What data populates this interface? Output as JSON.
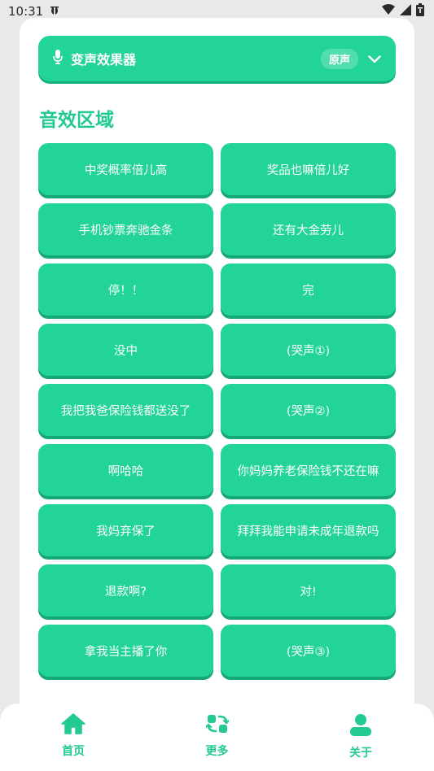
{
  "status_bar": {
    "time": "10:31",
    "carrier_icon": "bug-icon",
    "icons": [
      "wifi-icon",
      "signal-icon",
      "battery-icon"
    ]
  },
  "voice_changer": {
    "title": "变声效果器",
    "icon": "microphone-icon",
    "selected": "原声",
    "dropdown_icon": "chevron-down-icon"
  },
  "section": {
    "title": "音效区域"
  },
  "sound_buttons": [
    "中奖概率倍儿高",
    "奖品也嘛倍儿好",
    "手机钞票奔驰金条",
    "还有大金劳儿",
    "停！！",
    "完",
    "没中",
    "(哭声①)",
    "我把我爸保险钱都送没了",
    "(哭声②)",
    "啊哈哈",
    "你妈妈养老保险钱不还在嘛",
    "我妈弃保了",
    "拜拜我能申请未成年退款吗",
    "退款啊?",
    "对!",
    "拿我当主播了你",
    "(哭声③)"
  ],
  "bottom_nav": {
    "items": [
      {
        "label": "首页",
        "icon": "home-icon"
      },
      {
        "label": "更多",
        "icon": "refresh-icon"
      },
      {
        "label": "关于",
        "icon": "user-icon"
      }
    ]
  },
  "colors": {
    "accent": "#22d39a",
    "accent_dark": "#17a877",
    "title": "#22c993"
  }
}
